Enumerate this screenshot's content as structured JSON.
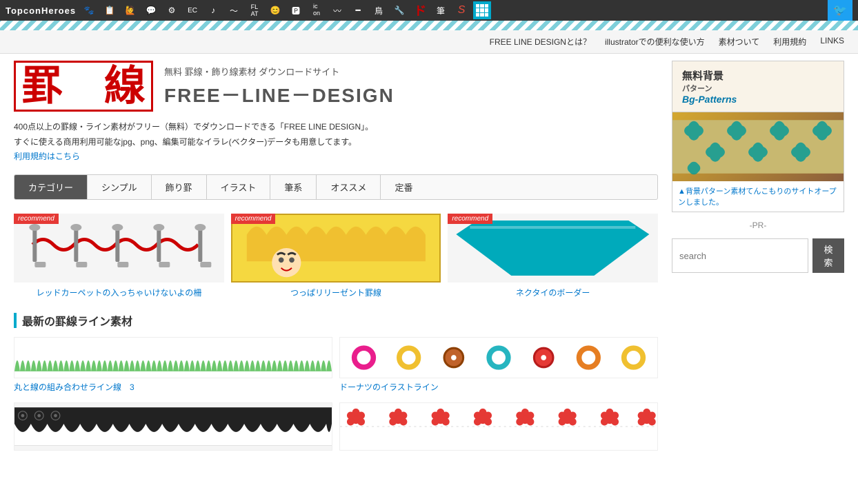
{
  "brand": "TopconHeroes",
  "twitter_icon": "🐦",
  "subnav": {
    "items": [
      {
        "label": "FREE LINE DESIGNとは？",
        "href": "#"
      },
      {
        "label": "illustratorでの便利な使い方",
        "href": "#"
      },
      {
        "label": "素材ついて",
        "href": "#"
      },
      {
        "label": "利用規約",
        "href": "#"
      },
      {
        "label": "LINKS",
        "href": "#"
      }
    ]
  },
  "logo": {
    "kanji": "罫　線",
    "subtitle": "無料  罫線・飾り線素材 ダウンロードサイト",
    "main_title": "FREE－LINE－DESIGN"
  },
  "description": {
    "line1": "400点以上の罫線・ライン素材がフリー（無料）でダウンロードできる「FREE LINE DESIGN」。",
    "line2": "すぐに使える商用利用可能なjpg、png、編集可能なイラレ(ベクター)データも用意してます。",
    "link_text": "利用規約はこちら"
  },
  "categories": [
    {
      "label": "カテゴリー",
      "active": true
    },
    {
      "label": "シンプル",
      "active": false
    },
    {
      "label": "飾り罫",
      "active": false
    },
    {
      "label": "イラスト",
      "active": false
    },
    {
      "label": "筆系",
      "active": false
    },
    {
      "label": "オススメ",
      "active": false
    },
    {
      "label": "定番",
      "active": false
    }
  ],
  "featured_cards": [
    {
      "badge": "recommend",
      "title": "レッドカーペットの入っちゃいけないよの柵",
      "type": "red-carpet"
    },
    {
      "badge": "recommend",
      "title": "つっぱリリーゼント罫線",
      "type": "regent"
    },
    {
      "badge": "recommend",
      "title": "ネクタイのボーダー",
      "type": "necktie"
    }
  ],
  "section_new": {
    "title": "最新の罫線ライン素材"
  },
  "new_materials": [
    {
      "title": "丸と線の組み合わせライン線　3",
      "type": "green-zigzag"
    },
    {
      "title": "ドーナツのイラストライン",
      "type": "donuts"
    }
  ],
  "bottom_materials": [
    {
      "title": "",
      "type": "black-lace"
    },
    {
      "title": "",
      "type": "flowers"
    }
  ],
  "sidebar": {
    "ad": {
      "header_title": "無料背景",
      "header_subtitle": "パターン",
      "header_brand": "Bg-Patterns",
      "caption": "▲背景パターン素材てんこもりのサイトオープンしました。"
    },
    "search": {
      "placeholder": "search",
      "button_label": "検索"
    },
    "pr_label": "-PR-"
  },
  "nav_icons": [
    "🐾",
    "📋",
    "🙋",
    "💬",
    "⚙",
    "EC",
    "♪",
    "〜",
    "FL",
    "AT",
    "😊",
    "P",
    "ic\non",
    "〰",
    "━",
    "鳥",
    "🔧",
    "ド",
    "筆",
    "S"
  ]
}
